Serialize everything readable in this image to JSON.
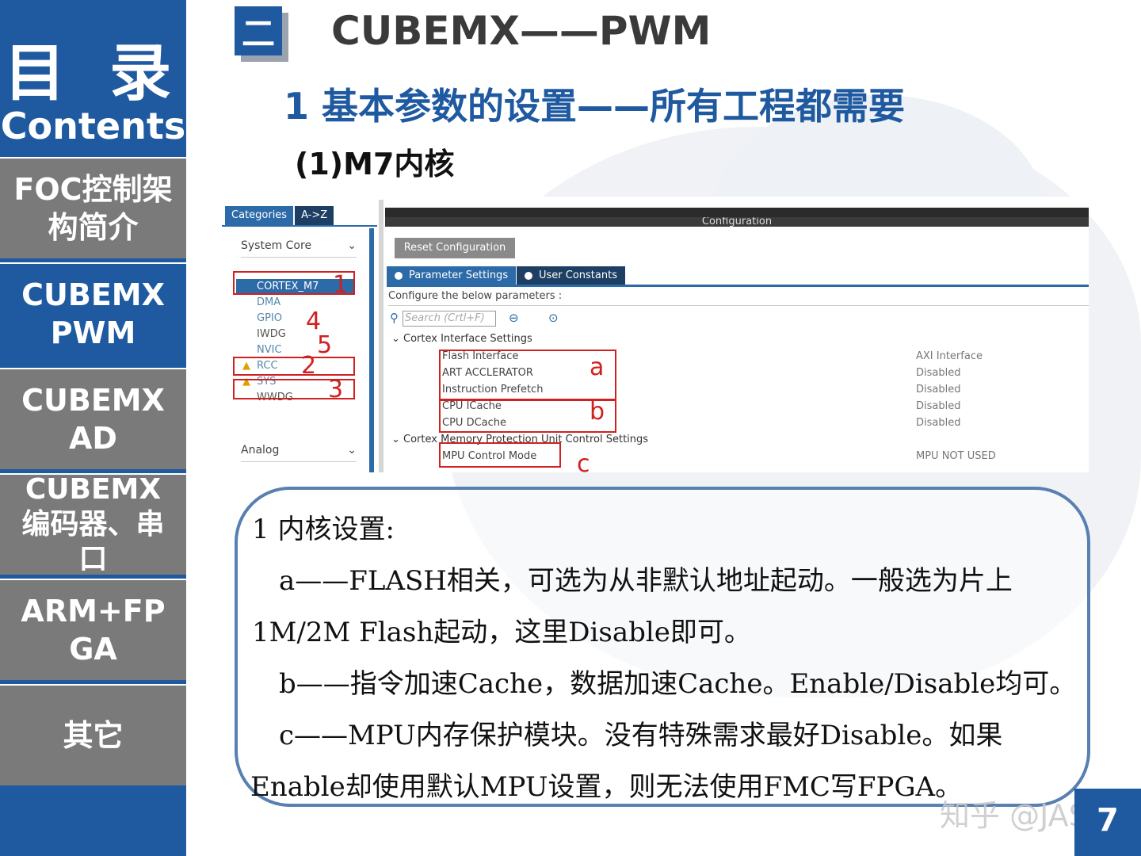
{
  "sidebar": {
    "head_title": "目 录",
    "head_subtitle": "Contents",
    "items": [
      {
        "label": "FOC控制架\n构简介",
        "state": "gray"
      },
      {
        "label": "CUBEMX\nPWM",
        "state": "active"
      },
      {
        "label": "CUBEMX\nAD",
        "state": "gray"
      },
      {
        "label": "CUBEMX\n编码器、串\n口",
        "state": "gray"
      },
      {
        "label": "ARM+FP\nGA",
        "state": "gray"
      },
      {
        "label": "其它",
        "state": "gray"
      }
    ]
  },
  "header": {
    "section_num": "二",
    "title": "CUBEMX——PWM",
    "subtitle": "1 基本参数的设置——所有工程都需要",
    "subsub": "(1)M7内核"
  },
  "screenshot": {
    "tab_categories": "Categories",
    "tab_az": "A->Z",
    "system_core": "System Core",
    "analog": "Analog",
    "periph": [
      "CORTEX_M7",
      "DMA",
      "GPIO",
      "IWDG",
      "NVIC",
      "RCC",
      "SYS",
      "WWDG"
    ],
    "config_title": "Configuration",
    "reset_btn": "Reset Configuration",
    "param_tab": "Parameter Settings",
    "user_tab": "User Constants",
    "configure_text": "Configure the below parameters :",
    "search_placeholder": "Search (Crtl+F)",
    "sect1": "Cortex Interface Settings",
    "sect2": "Cortex Memory Protection Unit Control Settings",
    "params": [
      {
        "name": "Flash Interface",
        "value": "AXI Interface"
      },
      {
        "name": "ART ACCLERATOR",
        "value": "Disabled"
      },
      {
        "name": "Instruction Prefetch",
        "value": "Disabled"
      },
      {
        "name": "CPU ICache",
        "value": "Disabled"
      },
      {
        "name": "CPU DCache",
        "value": "Disabled"
      },
      {
        "name": "MPU Control Mode",
        "value": "MPU NOT USED"
      }
    ],
    "marks_num": [
      "1",
      "2",
      "3",
      "4",
      "5"
    ],
    "marks_letter": [
      "a",
      "b",
      "c"
    ]
  },
  "note": {
    "lines": [
      "1 内核设置:",
      "a——FLASH相关，可选为从非默认地址起动。一般选为片上",
      "1M/2M Flash起动，这里Disable即可。",
      "b——指令加速Cache，数据加速Cache。Enable/Disable均可。",
      "c——MPU内存保护模块。没有特殊需求最好Disable。如果",
      "Enable却使用默认MPU设置，则无法使用FMC写FPGA。"
    ]
  },
  "watermark": "知乎 @JAS",
  "page_number": "7",
  "colors": {
    "accent": "#1f5aa0",
    "gray": "#7a7a7a",
    "mark": "#d02020"
  }
}
